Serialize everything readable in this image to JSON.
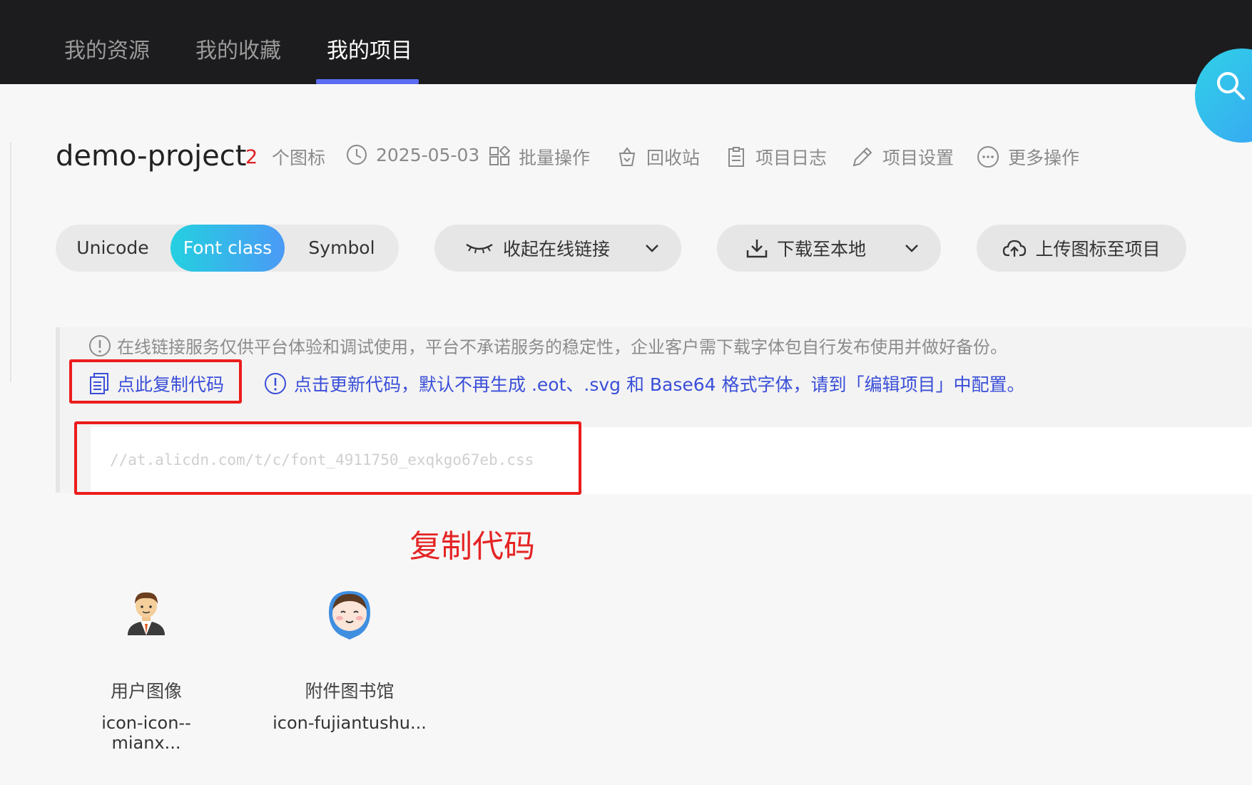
{
  "topnav": {
    "tabs": [
      {
        "label": "我的资源",
        "active": false
      },
      {
        "label": "我的收藏",
        "active": false
      },
      {
        "label": "我的项目",
        "active": true
      }
    ],
    "search_icon": "search-icon"
  },
  "project": {
    "name": "demo-project",
    "icon_count": "2",
    "icon_count_suffix": "个图标",
    "date": "2025-05-03",
    "actions": [
      {
        "label": "批量操作",
        "icon": "batch-icon"
      },
      {
        "label": "回收站",
        "icon": "recycle-bin-icon"
      },
      {
        "label": "项目日志",
        "icon": "log-icon"
      },
      {
        "label": "项目设置",
        "icon": "settings-pencil-icon"
      },
      {
        "label": "更多操作",
        "icon": "more-icon"
      }
    ]
  },
  "toolbar": {
    "segments": [
      {
        "label": "Unicode",
        "active": false
      },
      {
        "label": "Font class",
        "active": true
      },
      {
        "label": "Symbol",
        "active": false
      }
    ],
    "collapse_link": "收起在线链接",
    "download": "下载至本地",
    "upload": "上传图标至项目"
  },
  "notice": {
    "disclaimer": "在线链接服务仅供平台体验和调试使用，平台不承诺服务的稳定性，企业客户需下载字体包自行发布使用并做好备份。",
    "copy_code": "点此复制代码",
    "update_code": "点击更新代码，默认不再生成 .eot、.svg 和 Base64 格式字体，请到「编辑项目」中配置。",
    "css_url": "//at.alicdn.com/t/c/font_4911750_exqkgo67eb.css"
  },
  "annotation": "复制代码",
  "icons": [
    {
      "name": "用户图像",
      "code": "icon-icon--mianx..."
    },
    {
      "name": "附件图书馆",
      "code": "icon-fujiantushu..."
    }
  ],
  "colors": {
    "accent_blue": "#3a4ed8",
    "highlight_red": "#ec1c1c",
    "gradient_start": "#24d0e0",
    "gradient_end": "#4a9af5",
    "topbar_bg": "#1c1c1e"
  }
}
